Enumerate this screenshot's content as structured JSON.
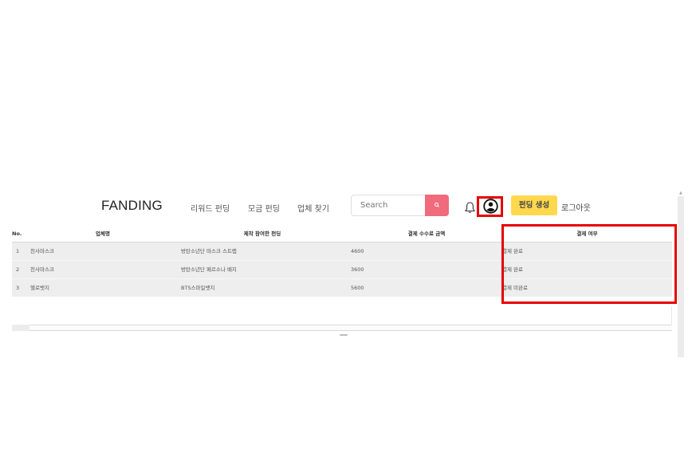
{
  "header": {
    "logo": "FANDING",
    "nav": [
      "리워드 펀딩",
      "모금 펀딩",
      "업체 찾기"
    ],
    "search_placeholder": "Search",
    "create_button": "펀딩 생성",
    "logout": "로그아웃"
  },
  "table": {
    "columns": [
      "No.",
      "업체명",
      "제작 참여한 펀딩",
      "결제 수수료 금액",
      "결제 여부"
    ],
    "rows": [
      {
        "no": "1",
        "vendor": "천사마스크",
        "funding": "방탄소년단 마스크 스트랩",
        "fee": "4600",
        "status": "결제 완료"
      },
      {
        "no": "2",
        "vendor": "천사마스크",
        "funding": "방탄소년단 페르소나 배지",
        "fee": "3600",
        "status": "결제 완료"
      },
      {
        "no": "3",
        "vendor": "헬로뱃지",
        "funding": "BTS스마일뱃지",
        "fee": "5600",
        "status": "결제 미완료"
      }
    ]
  },
  "colors": {
    "search_button": "#f06b7c",
    "create_button": "#ffd84d",
    "highlight": "#e60000"
  }
}
